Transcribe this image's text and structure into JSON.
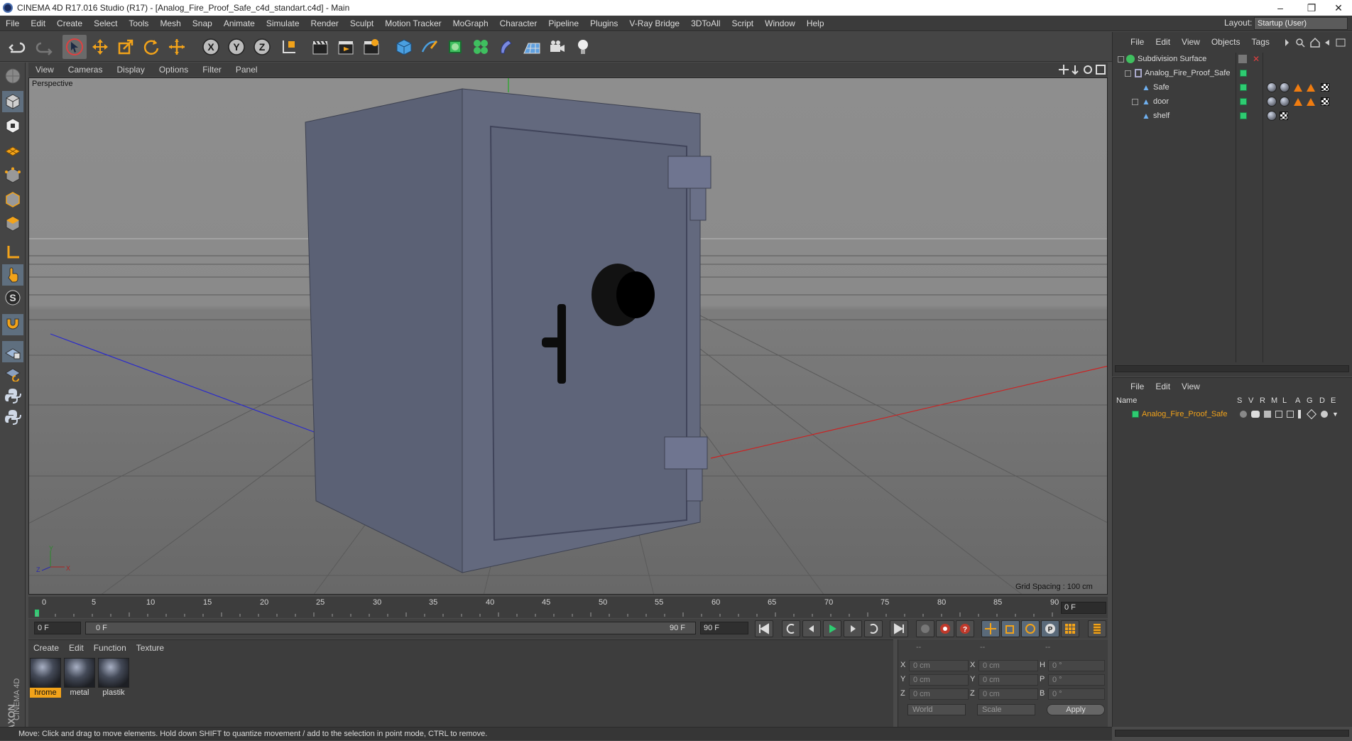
{
  "window": {
    "title": "CINEMA 4D R17.016 Studio (R17) - [Analog_Fire_Proof_Safe_c4d_standart.c4d] - Main",
    "minimize": "–",
    "restore": "❐",
    "close": "✕"
  },
  "menu": [
    "File",
    "Edit",
    "Create",
    "Select",
    "Tools",
    "Mesh",
    "Snap",
    "Animate",
    "Simulate",
    "Render",
    "Sculpt",
    "Motion Tracker",
    "MoGraph",
    "Character",
    "Pipeline",
    "Plugins",
    "V-Ray Bridge",
    "3DToAll",
    "Script",
    "Window",
    "Help"
  ],
  "layout": {
    "label": "Layout:",
    "value": "Startup (User)"
  },
  "viewport": {
    "menu": [
      "View",
      "Cameras",
      "Display",
      "Options",
      "Filter",
      "Panel"
    ],
    "label": "Perspective",
    "grid_spacing": "Grid Spacing : 100 cm",
    "axis_y": "Y",
    "axis_x": "X",
    "axis_z": "Z"
  },
  "timeline": {
    "ticks": [
      "0",
      "5",
      "10",
      "15",
      "20",
      "25",
      "30",
      "35",
      "40",
      "45",
      "50",
      "55",
      "60",
      "65",
      "70",
      "75",
      "80",
      "85",
      "90"
    ],
    "end_field": "0 F",
    "current": "0 F",
    "range_start": "0 F",
    "range_end": "90 F",
    "max": "90 F"
  },
  "material_manager": {
    "menu": [
      "Create",
      "Edit",
      "Function",
      "Texture"
    ],
    "materials": [
      {
        "name": "chrome",
        "label": "hrome",
        "selected": true
      },
      {
        "name": "metal",
        "label": "metal",
        "selected": false
      },
      {
        "name": "plastik",
        "label": "plastik",
        "selected": false
      }
    ],
    "brand_top": "MAXON",
    "brand_bottom": "CINEMA 4D"
  },
  "coordinates": {
    "dashes": [
      "--",
      "--",
      "--"
    ],
    "rows": [
      {
        "a": "X",
        "a_val": "0 cm",
        "b": "X",
        "b_val": "0 cm",
        "c": "H",
        "c_val": "0 °"
      },
      {
        "a": "Y",
        "a_val": "0 cm",
        "b": "Y",
        "b_val": "0 cm",
        "c": "P",
        "c_val": "0 °"
      },
      {
        "a": "Z",
        "a_val": "0 cm",
        "b": "Z",
        "b_val": "0 cm",
        "c": "B",
        "c_val": "0 °"
      }
    ],
    "space": "World",
    "mode": "Scale",
    "apply": "Apply"
  },
  "object_manager": {
    "menu": [
      "File",
      "Edit",
      "View",
      "Objects",
      "Tags"
    ],
    "objects": [
      {
        "name": "Subdivision Surface",
        "indent": 0
      },
      {
        "name": "Analog_Fire_Proof_Safe",
        "indent": 1
      },
      {
        "name": "Safe",
        "indent": 2
      },
      {
        "name": "door",
        "indent": 2
      },
      {
        "name": "shelf",
        "indent": 2
      }
    ]
  },
  "attribute_manager": {
    "menu": [
      "File",
      "Edit",
      "View"
    ],
    "columns": [
      "Name",
      "S",
      "V",
      "R",
      "M",
      "L",
      "A",
      "G",
      "D",
      "E"
    ],
    "row": "Analog_Fire_Proof_Safe"
  },
  "status": "Move: Click and drag to move elements. Hold down SHIFT to quantize movement / add to the selection in point mode, CTRL to remove."
}
